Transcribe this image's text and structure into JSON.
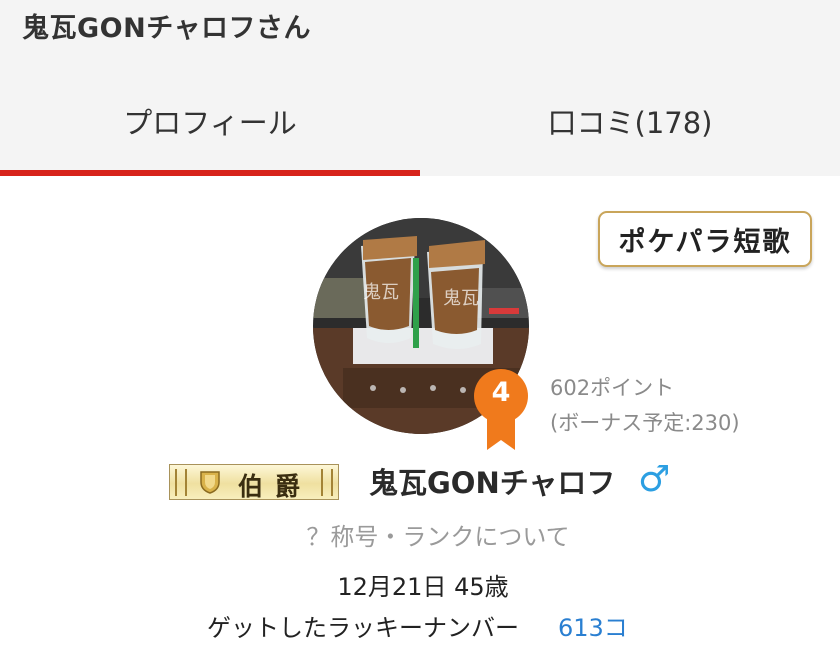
{
  "header": {
    "title": "鬼瓦GONチャロフさん"
  },
  "tabs": [
    {
      "label": "プロフィール",
      "active": true
    },
    {
      "label": "口コミ(178)",
      "active": false
    }
  ],
  "colors": {
    "accent": "#d7231b",
    "badge": "#f07a1c",
    "link": "#2a7fd1",
    "gender": "#2c9fe2",
    "button_border": "#c9a55a"
  },
  "profile": {
    "tanka_button": "ポケパラ短歌",
    "rank_badge": "4",
    "points": "602ポイント",
    "bonus": "(ボーナス予定:230)",
    "title_plate": "伯爵",
    "username": "鬼瓦GONチャロフ",
    "gender_symbol": "♂",
    "rank_link": "？称号・ランクについて",
    "birthday": "12月21日 45歳",
    "lucky_label": "ゲットしたラッキーナンバー",
    "lucky_value": "613コ"
  },
  "icons": {
    "avatar": "profile-photo",
    "badge": "rank-ribbon-icon",
    "plate": "shield-icon",
    "gender": "male-icon"
  }
}
